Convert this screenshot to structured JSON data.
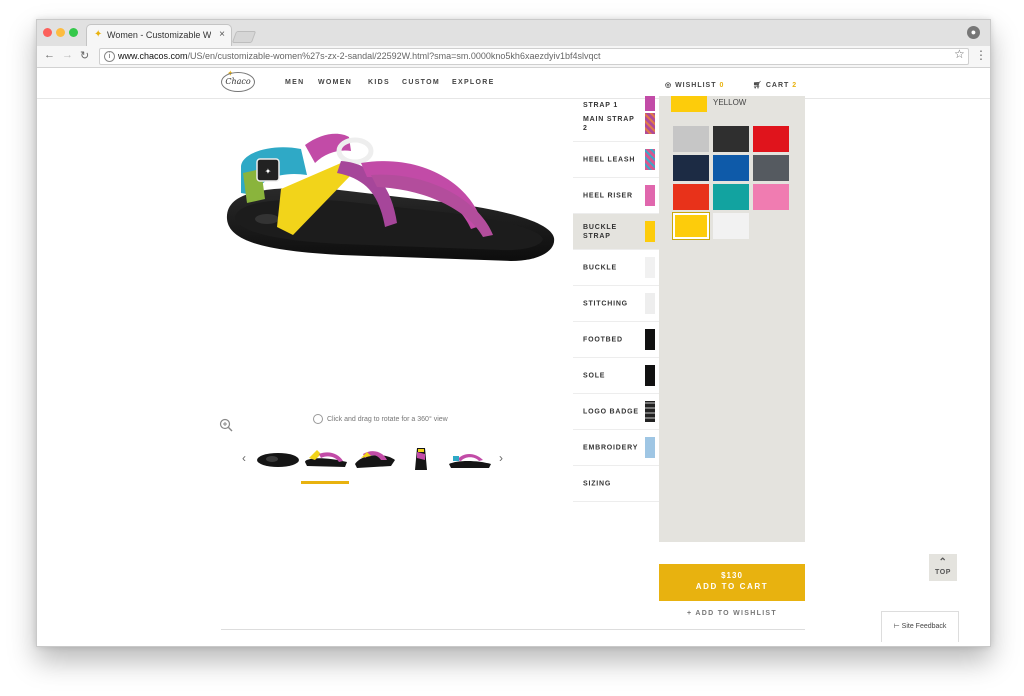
{
  "browser": {
    "tab_title": "Women - Customizable Wome",
    "tab_close": "×",
    "url_host": "www.chacos.com",
    "url_path": "/US/en/customizable-women%27s-zx-2-sandal/22592W.html?sma=sm.0000kno5kh6xaezdyiv1bf4slvqct"
  },
  "header": {
    "logo_text": "Chaco",
    "nav": [
      "MEN",
      "WOMEN",
      "KIDS",
      "CUSTOM",
      "EXPLORE"
    ],
    "wishlist_label": "WISHLIST",
    "wishlist_count": "0",
    "cart_label": "CART",
    "cart_count": "2"
  },
  "viewer": {
    "rotate_hint": "Click and drag to rotate for a 360° view",
    "prev_arrow": "‹",
    "next_arrow": "›",
    "thumbnail_count": 5,
    "selected_thumbnail_index": 1
  },
  "parts": [
    {
      "label": "STRAP 1",
      "color": "#c24ba7"
    },
    {
      "label": "MAIN STRAP 2",
      "color": "#b14a97",
      "pattern": true
    },
    {
      "label": "HEEL LEASH",
      "color": "#d9568e",
      "pattern": true
    },
    {
      "label": "HEEL RISER",
      "color": "#e067ad"
    },
    {
      "label": "BUCKLE STRAP",
      "color": "#fdcc0b",
      "active": true
    },
    {
      "label": "BUCKLE",
      "color": "#f1f1f1"
    },
    {
      "label": "STITCHING",
      "color": "#eeeeee"
    },
    {
      "label": "FOOTBED",
      "color": "#111111"
    },
    {
      "label": "SOLE",
      "color": "#111111"
    },
    {
      "label": "LOGO BADGE",
      "color": "#333333",
      "pattern": true
    },
    {
      "label": "EMBROIDERY",
      "color": "#9fc6e4"
    },
    {
      "label": "SIZING",
      "color": ""
    }
  ],
  "color_panel": {
    "selected_name": "YELLOW",
    "selected_color": "#fdcc0b",
    "swatches": [
      "#c6c6c6",
      "#2f2f2f",
      "#e0141c",
      "#1c2b44",
      "#0e5aa9",
      "#555a60",
      "#e8321a",
      "#12a3a0",
      "#f07cb1",
      "#fdcc0b",
      "#f2f2f2"
    ],
    "selected_index": 9
  },
  "cart": {
    "price": "$130",
    "add_label": "ADD TO CART",
    "wishlist_link": "+ ADD TO WISHLIST"
  },
  "page": {
    "top_label": "TOP",
    "feedback_label": "Site Feedback"
  },
  "colors": {
    "accent": "#e8b20f",
    "panel_bg": "#e4e3de"
  }
}
